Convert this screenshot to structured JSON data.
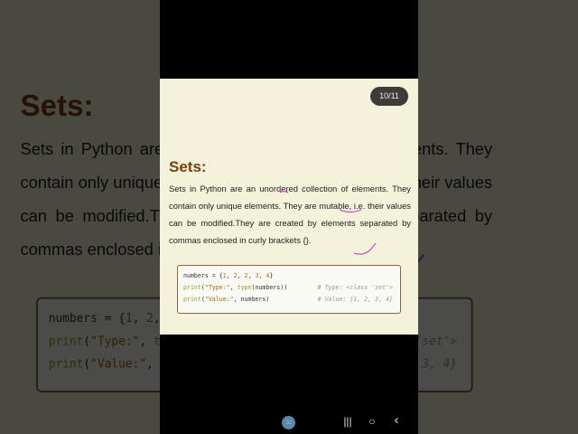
{
  "slide": {
    "page_indicator": "10/11",
    "title": "Sets:",
    "body": "Sets in Python are an unordered collection of elements. They contain only unique elements. They are mutable, i.e. their values can be modified.They are created by elements separated by commas enclosed in curly brackets {}.",
    "code": {
      "line1": {
        "a": "numbers = {",
        "n1": "1",
        "s1": ", ",
        "n2": "2",
        "s2": ", ",
        "n3": "2",
        "s3": ", ",
        "n4": "3",
        "s4": ", ",
        "n5": "4",
        "e": "}"
      },
      "line2": {
        "kw": "print",
        "p": "(",
        "str": "\"Type:\"",
        "m": ", ",
        "kw2": "type",
        "rest": "(numbers))",
        "comment": "# Type: <class 'set'>"
      },
      "line3": {
        "kw": "print",
        "p": "(",
        "str": "\"Value:\"",
        "rest": ", numbers)",
        "comment": "# Value: {1, 2, 3, 4}"
      }
    }
  },
  "navbar": {
    "apps_icon": "grid-icon",
    "recents_icon": "|||",
    "home_icon": "○",
    "back_icon": "‹"
  },
  "colors": {
    "title": "#7a3e10",
    "slide_bg": "#f4f2da",
    "annotation": "#c050d0"
  }
}
